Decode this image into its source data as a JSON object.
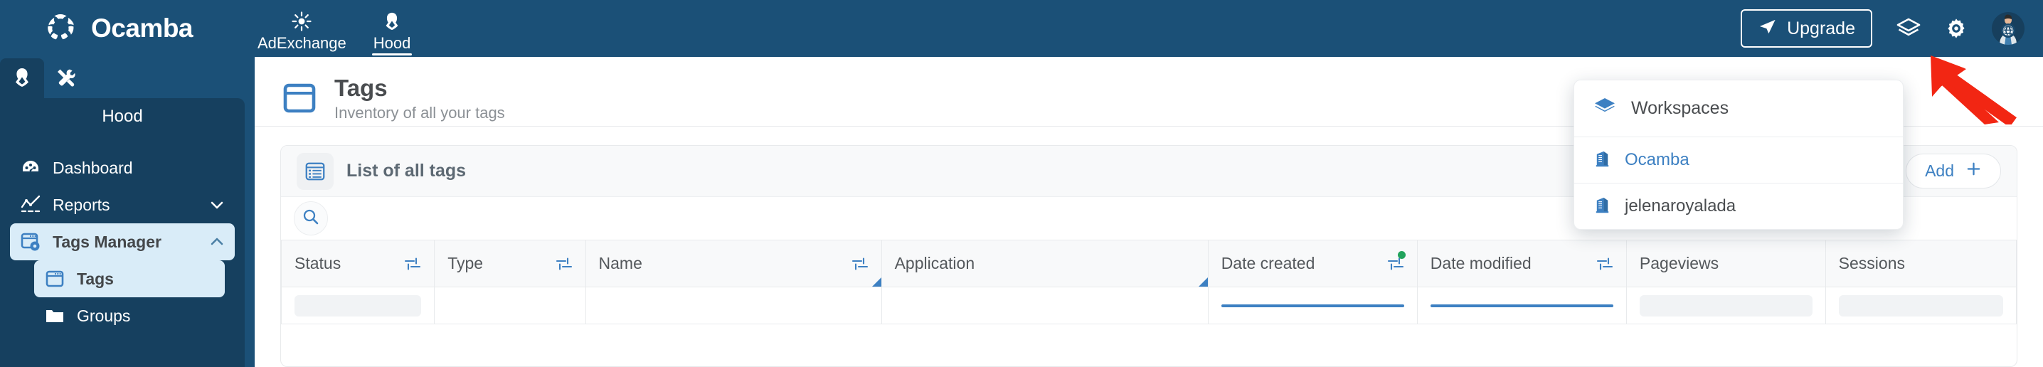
{
  "brand": {
    "name": "Ocamba",
    "logo_icon": "ocamba-logo-icon"
  },
  "topnav": {
    "items": [
      {
        "label": "AdExchange",
        "icon": "sun-burst-icon",
        "active": false
      },
      {
        "label": "Hood",
        "icon": "hood-icon",
        "active": true
      }
    ]
  },
  "topright": {
    "upgrade_label": "Upgrade",
    "upgrade_icon": "paper-plane-icon",
    "layers_icon": "layers-icon",
    "settings_icon": "gear-icon",
    "avatar_icon": "user-avatar-icon"
  },
  "sidebar": {
    "tabs": [
      {
        "icon": "hood-icon",
        "active": true
      },
      {
        "icon": "tools-icon",
        "active": false
      }
    ],
    "section_title": "Hood",
    "items": [
      {
        "label": "Dashboard",
        "icon": "dashboard-icon",
        "selected": false,
        "chevron": ""
      },
      {
        "label": "Reports",
        "icon": "reports-chart-icon",
        "selected": false,
        "chevron": "down"
      },
      {
        "label": "Tags Manager",
        "icon": "tags-manager-icon",
        "selected": true,
        "chevron": "up"
      }
    ],
    "sub_items": [
      {
        "label": "Tags",
        "icon": "tag-window-icon",
        "selected": true
      },
      {
        "label": "Groups",
        "icon": "folder-icon",
        "selected": false
      }
    ]
  },
  "page": {
    "icon": "tag-window-icon",
    "title": "Tags",
    "subtitle": "Inventory of all your tags"
  },
  "card": {
    "icon": "list-icon",
    "title": "List of all tags",
    "add_label": "Add",
    "add_icon": "plus-icon",
    "search_icon": "search-icon"
  },
  "table": {
    "columns": [
      {
        "label": "Status",
        "filter": true,
        "filter_active": false,
        "resize_marker": false
      },
      {
        "label": "Type",
        "filter": true,
        "filter_active": false,
        "resize_marker": false
      },
      {
        "label": "Name",
        "filter": true,
        "filter_active": false,
        "resize_marker": true
      },
      {
        "label": "Application",
        "filter": false,
        "filter_active": false,
        "resize_marker": true
      },
      {
        "label": "Date created",
        "filter": true,
        "filter_active": true,
        "resize_marker": false
      },
      {
        "label": "Date modified",
        "filter": true,
        "filter_active": false,
        "resize_marker": false
      },
      {
        "label": "Pageviews",
        "filter": false,
        "filter_active": false,
        "resize_marker": false
      },
      {
        "label": "Sessions",
        "filter": false,
        "filter_active": false,
        "resize_marker": false
      }
    ]
  },
  "workspaces_dropdown": {
    "header_label": "Workspaces",
    "header_icon": "layers-icon",
    "items": [
      {
        "label": "Ocamba",
        "icon": "building-icon",
        "active": true
      },
      {
        "label": "jelenaroyalada",
        "icon": "building-icon",
        "active": false
      }
    ]
  },
  "annotation": {
    "arrow_color": "#f22613"
  },
  "colors": {
    "topbar_navy": "#1b5077",
    "sidebar_navy": "#16405f",
    "accent_blue": "#3d80c2",
    "selected_item_bg": "#d9ecf8",
    "status_green": "#22a35c"
  }
}
